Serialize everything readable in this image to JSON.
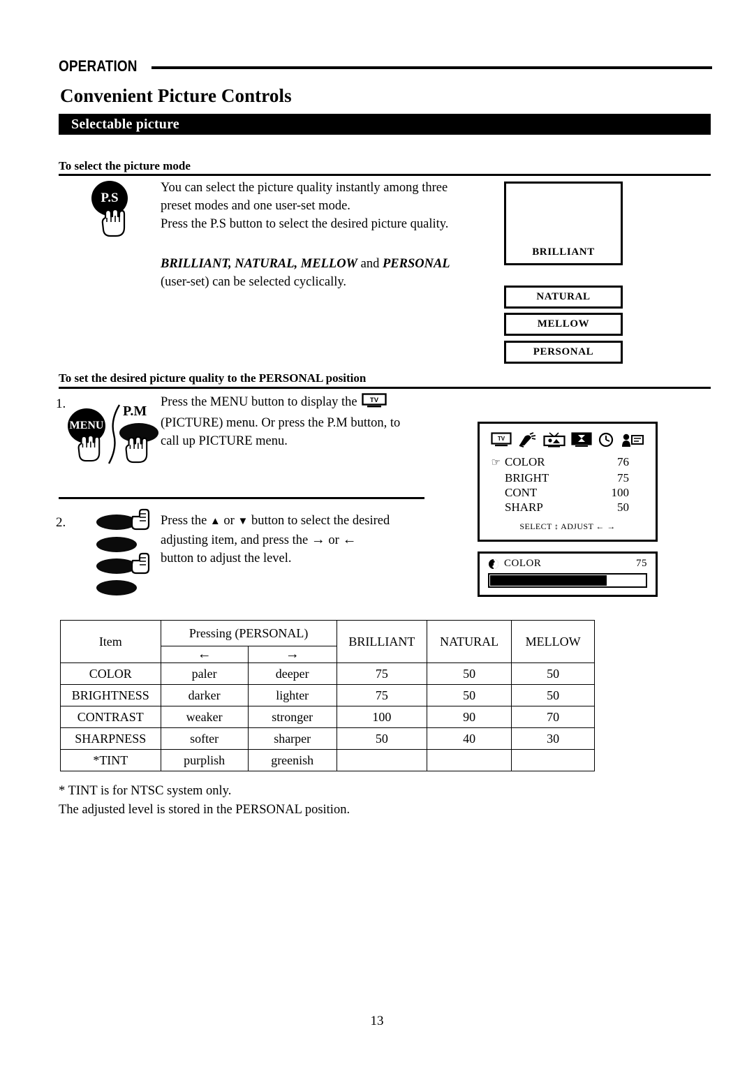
{
  "header": {
    "section_label": "OPERATION",
    "title": "Convenient Picture Controls",
    "banner": "Selectable picture"
  },
  "section1": {
    "heading": "To select the picture mode",
    "para1_line1": "You can select the picture quality instantly among three",
    "para1_line2": "preset modes and one user-set mode.",
    "para1_line3": "Press the P.S button to select the desired picture quality.",
    "emphasis_line": "BRILLIANT, NATURAL, MELLOW",
    "emphasis_and": " and ",
    "emphasis_tail": "PERSONAL",
    "para2_line2": "(user-set) can be selected cyclically.",
    "button_label": "P.S",
    "modes": [
      {
        "label": "BRILLIANT"
      },
      {
        "label": "NATURAL"
      },
      {
        "label": "MELLOW"
      },
      {
        "label": "PERSONAL"
      }
    ]
  },
  "section2": {
    "heading": "To set the desired picture quality to the PERSONAL position",
    "step1": {
      "number": "1.",
      "menu_button_label": "MENU",
      "pm_button_label": "P.M",
      "line1_a": "Press the MENU button to display the",
      "line1_tv_icon": "tv-icon",
      "line2": "(PICTURE) menu. Or press the P.M button, to",
      "line3": "call up PICTURE menu."
    },
    "step2": {
      "number": "2.",
      "line1_a": "Press the",
      "line1_up": "▲",
      "line1_or": "or",
      "line1_down": "▼",
      "line1_b": "button to select the desired",
      "line2_a": "adjusting item, and press the",
      "line2_right": "→",
      "line2_or": "or",
      "line2_left": "←",
      "line3": "button to adjust the level."
    }
  },
  "osd_menu": {
    "icons": [
      "tv-icon",
      "satellite-dish-icon",
      "picture-tv-icon",
      "hourglass-tv-icon",
      "clock-icon",
      "person-caption-icon"
    ],
    "cursor": "☞",
    "rows": [
      {
        "label": "COLOR",
        "value": "76",
        "selected": true
      },
      {
        "label": "BRIGHT",
        "value": "75",
        "selected": false
      },
      {
        "label": "CONT",
        "value": "100",
        "selected": false
      },
      {
        "label": "SHARP",
        "value": "50",
        "selected": false
      }
    ],
    "footer_select": "SELECT",
    "footer_select_arrows": "↕",
    "footer_adjust": "ADJUST",
    "footer_adjust_arrows": "← →"
  },
  "osd_bar": {
    "icon": "color-circle-icon",
    "label": "COLOR",
    "value": "75",
    "fill_percent": 75
  },
  "table": {
    "header": {
      "item": "Item",
      "pressing": "Pressing (PERSONAL)",
      "left_arrow": "←",
      "right_arrow": "→",
      "cols": [
        "BRILLIANT",
        "NATURAL",
        "MELLOW"
      ]
    },
    "rows": [
      {
        "item": "COLOR",
        "left": "paler",
        "right": "deeper",
        "brilliant": "75",
        "natural": "50",
        "mellow": "50"
      },
      {
        "item": "BRIGHTNESS",
        "left": "darker",
        "right": "lighter",
        "brilliant": "75",
        "natural": "50",
        "mellow": "50"
      },
      {
        "item": "CONTRAST",
        "left": "weaker",
        "right": "stronger",
        "brilliant": "100",
        "natural": "90",
        "mellow": "70"
      },
      {
        "item": "SHARPNESS",
        "left": "softer",
        "right": "sharper",
        "brilliant": "50",
        "natural": "40",
        "mellow": "30"
      },
      {
        "item": "*TINT",
        "left": "purplish",
        "right": "greenish",
        "brilliant": "",
        "natural": "",
        "mellow": ""
      }
    ]
  },
  "footnotes": {
    "line1": "* TINT is for NTSC system only.",
    "line2": "The adjusted level is stored in the PERSONAL position."
  },
  "page_number": "13"
}
